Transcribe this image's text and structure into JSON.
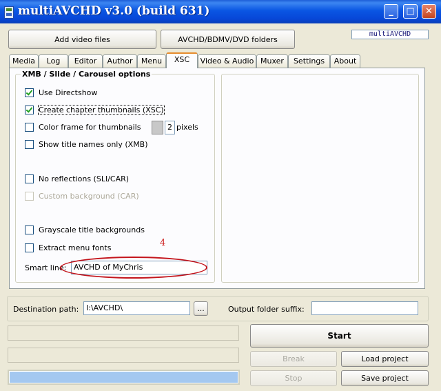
{
  "window": {
    "title": "multiAVCHD v3.0 (build 631)",
    "logo_text": "multiAVCHD",
    "controls": {
      "minimize": "_",
      "maximize": "□",
      "close": "✕"
    }
  },
  "toolbar": {
    "add_video_label": "Add video files",
    "folders_label": "AVCHD/BDMV/DVD folders"
  },
  "tabs": [
    {
      "label": "Media"
    },
    {
      "label": "Log"
    },
    {
      "label": "Editor"
    },
    {
      "label": "Author"
    },
    {
      "label": "Menu"
    },
    {
      "label": "XSC",
      "active": true
    },
    {
      "label": "Video & Audio"
    },
    {
      "label": "Muxer"
    },
    {
      "label": "Settings"
    },
    {
      "label": "About"
    }
  ],
  "xsc": {
    "group_title": "XMB / Slide / Carousel options",
    "options": [
      {
        "label": "Use Directshow",
        "checked": true,
        "enabled": true
      },
      {
        "label": "Create chapter thumbnails (XSC)",
        "checked": true,
        "enabled": true
      },
      {
        "label": "Color frame for thumbnails",
        "checked": false,
        "enabled": true
      },
      {
        "label": "Show title names only (XMB)",
        "checked": false,
        "enabled": true
      },
      {
        "label": "No reflections (SLI/CAR)",
        "checked": false,
        "enabled": true
      },
      {
        "label": "Custom background (CAR)",
        "checked": false,
        "enabled": false
      },
      {
        "label": "Grayscale title backgrounds",
        "checked": false,
        "enabled": true
      },
      {
        "label": "Extract menu fonts",
        "checked": false,
        "enabled": true
      }
    ],
    "frame_width": "2",
    "pixels_label": "pixels",
    "annotation": "4",
    "smart_line_label": "Smart line:",
    "smart_line_value": "AVCHD of MyChris"
  },
  "destination": {
    "path_label": "Destination path:",
    "path_value": "I:\\AVCHD\\",
    "browse_label": "...",
    "suffix_label": "Output folder suffix:",
    "suffix_value": ""
  },
  "actions": {
    "start_label": "Start",
    "break_label": "Break",
    "load_label": "Load project",
    "stop_label": "Stop",
    "save_label": "Save project"
  },
  "progress": {
    "fraction": 1.0
  },
  "colors": {
    "titlebar": "#0a56e3",
    "annotation_red": "#cc1d1d",
    "progress_fill": "#a4c8f0",
    "tab_highlight": "#e68b2c"
  }
}
